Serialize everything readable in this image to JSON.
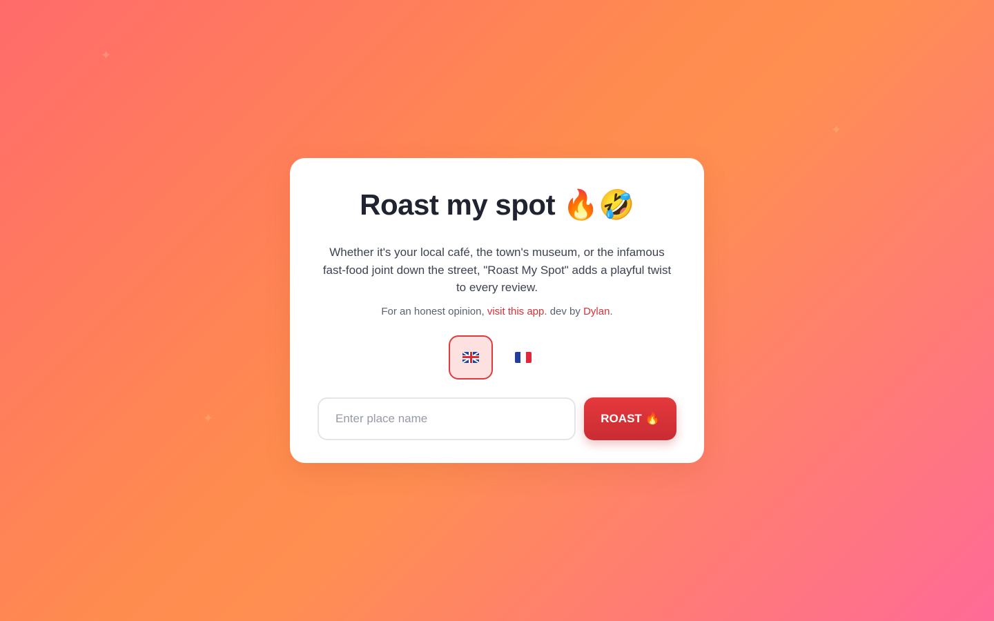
{
  "background": {
    "decorations": [
      "✦",
      "✦",
      "✦"
    ]
  },
  "card": {
    "title": "Roast my spot 🔥🤣",
    "description": "Whether it's your local café, the town's museum, or the infamous fast-food joint down the street, \"Roast My Spot\" adds a playful twist to every review.",
    "credits": {
      "prefix": "For an honest opinion, ",
      "link_label": "visit this app",
      "middle": ". dev by ",
      "author_label": "Dylan",
      "suffix": "."
    },
    "languages": [
      {
        "code": "en",
        "icon": "uk-flag-icon",
        "selected": true
      },
      {
        "code": "fr",
        "icon": "france-flag-icon",
        "selected": false
      }
    ],
    "form": {
      "input_value": "",
      "input_placeholder": "Enter place name",
      "submit_label": "ROAST 🔥"
    }
  },
  "colors": {
    "accent": "#dc2f35",
    "title": "#1f2430",
    "selected_bg": "#fde0e0"
  }
}
